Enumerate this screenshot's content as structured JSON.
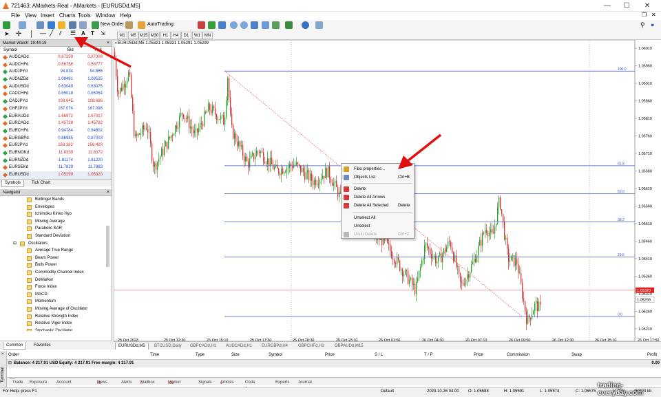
{
  "window": {
    "title": "721463: AMarkets-Real - AMarkets - [EURUSDd,M5]",
    "controls": [
      "—",
      "☐",
      "✕"
    ]
  },
  "menu": [
    "File",
    "View",
    "Insert",
    "Charts",
    "Tools",
    "Window",
    "Help"
  ],
  "toolbar": {
    "new_order": "New Order",
    "autotrading": "AutoTrading",
    "timeframes": [
      "M1",
      "M5",
      "M15",
      "M30",
      "H1",
      "H4",
      "D1",
      "W1",
      "MN"
    ]
  },
  "market_watch": {
    "title": "Market Watch: 19:44:19",
    "columns": [
      "Symbol",
      "Bid",
      "Ask"
    ],
    "rows": [
      {
        "symbol": "AUDCADd",
        "bid": "0.87259",
        "ask": "0.87308",
        "color": "#d62b2b"
      },
      {
        "symbol": "AUDCHFd",
        "bid": "0.56756",
        "ask": "0.56777",
        "color": "#d62b2b"
      },
      {
        "symbol": "AUDJPYd",
        "bid": "94.834",
        "ask": "94.865",
        "color": "#2147d8"
      },
      {
        "symbol": "AUDNZDd",
        "bid": "1.08481",
        "ask": "1.08525",
        "color": "#2147d8"
      },
      {
        "symbol": "AUDUSDd",
        "bid": "0.63049",
        "ask": "0.63075",
        "color": "#2147d8"
      },
      {
        "symbol": "CADCHFd",
        "bid": "0.65018",
        "ask": "0.65054",
        "color": "#2147d8"
      },
      {
        "symbol": "CADJPYd",
        "bid": "108.645",
        "ask": "108.686",
        "color": "#d62b2b"
      },
      {
        "symbol": "CHFJPYd",
        "bid": "167.074",
        "ask": "167.098",
        "color": "#2147d8"
      },
      {
        "symbol": "EURAUDd",
        "bid": "1.66972",
        "ask": "1.67017",
        "color": "#d62b2b"
      },
      {
        "symbol": "EURCADd",
        "bid": "1.45738",
        "ask": "1.45782",
        "color": "#d62b2b"
      },
      {
        "symbol": "EURCHFd",
        "bid": "0.94784",
        "ask": "0.94802",
        "color": "#2147d8"
      },
      {
        "symbol": "EURGBPd",
        "bid": "0.86985",
        "ask": "0.87003",
        "color": "#2147d8"
      },
      {
        "symbol": "EURJPYd",
        "bid": "158.382",
        "ask": "158.403",
        "color": "#d62b2b"
      },
      {
        "symbol": "EURNOKd",
        "bid": "11.8339",
        "ask": "11.8372",
        "color": "#d62b2b"
      },
      {
        "symbol": "EURNZDd",
        "bid": "1.81174",
        "ask": "1.81220",
        "color": "#2147d8"
      },
      {
        "symbol": "EURSEKd",
        "bid": "11.7829",
        "ask": "11.7883",
        "color": "#2147d8"
      },
      {
        "symbol": "EURUSDd",
        "bid": "1.05299",
        "ask": "1.05320",
        "color": "#d62b2b"
      }
    ],
    "tabs": [
      "Symbols",
      "Tick Chart"
    ]
  },
  "navigator": {
    "title": "Navigator",
    "items": [
      "Bollinger Bands",
      "Envelopes",
      "Ichimoku Kinko Hyo",
      "Moving Average",
      "Parabolic SAR",
      "Standard Deviation"
    ],
    "group": "Oscillators",
    "oscillators": [
      "Average True Range",
      "Bears Power",
      "Bulls Power",
      "Commodity Channel Index",
      "DeMarker",
      "Force Index",
      "MACD",
      "Momentum",
      "Moving Average of Oscillator",
      "Relative Strength Index",
      "Relative Vigor Index",
      "Stochastic Oscillator"
    ],
    "tabs": [
      "Common",
      "Favorites"
    ]
  },
  "chart": {
    "header": "EURUSDd,M5  1.05321 1.05321 1.05291 1.05299",
    "price_labels": [
      "1.06010",
      "1.05960",
      "1.05910",
      "1.05860",
      "1.05810",
      "1.05760",
      "1.05710",
      "1.05660",
      "1.05610",
      "1.05560",
      "1.05510",
      "1.05460",
      "1.05410",
      "1.05360",
      "1.05310",
      "1.05260",
      "1.05210"
    ],
    "time_labels": [
      "25 Oct 2023",
      "25 Oct 12:30",
      "25 Oct 15:10",
      "25 Oct 17:50",
      "25 Oct 20:30",
      "25 Oct 23:10",
      "26 Oct 01:50",
      "26 Oct 04:30",
      "26 Oct 07:10",
      "26 Oct 09:50",
      "26 Oct 12:30",
      "26 Oct 15:10",
      "26 Oct 17:50"
    ],
    "fibo_levels": [
      "100.0",
      "61.8",
      "50.0",
      "38.2",
      "23.6",
      "0.0"
    ],
    "bid_price": "1.05320",
    "ask_price": "1.05299",
    "tabs": [
      "EURUSDd,M5",
      "BTCUSD,Daily",
      "GBPCADd,H1",
      "AUDCADd,H1",
      "EURGBPd,H4",
      "GBPCHFd,H1",
      "GBPAUDd,M15"
    ]
  },
  "context_menu": {
    "items": [
      {
        "label": "Fibo properties...",
        "key": "",
        "icon": "fibo-properties-icon"
      },
      {
        "label": "Objects List",
        "key": "Ctrl+B",
        "icon": "objects-list-icon"
      },
      {
        "label": "Delete",
        "key": "",
        "icon": "delete-icon"
      },
      {
        "label": "Delete All Arrows",
        "key": "",
        "icon": "delete-arrows-icon"
      },
      {
        "label": "Delete All Selected",
        "key": "Delete",
        "icon": "delete-selected-icon"
      },
      {
        "label": "Unselect All",
        "key": "",
        "icon": ""
      },
      {
        "label": "Unselect",
        "key": "",
        "icon": ""
      },
      {
        "label": "Undo Delete",
        "key": "Ctrl+Z",
        "icon": "undo-icon"
      }
    ]
  },
  "terminal": {
    "side_label": "Terminal",
    "columns": [
      "Order",
      "Time",
      "Type",
      "Size",
      "Symbol",
      "Price",
      "S / L",
      "T / P",
      "Price",
      "Commission",
      "Swap",
      "Profit"
    ],
    "balance": "Balance: 4 217.91 USD  Equity: 4 217.91  Free margin: 4 217.91",
    "profit": "0.00",
    "tabs": [
      {
        "label": "Trade",
        "badge": ""
      },
      {
        "label": "Exposure",
        "badge": ""
      },
      {
        "label": "Account History",
        "badge": ""
      },
      {
        "label": "News",
        "badge": "99"
      },
      {
        "label": "Alerts",
        "badge": ""
      },
      {
        "label": "Mailbox",
        "badge": "6"
      },
      {
        "label": "Market",
        "badge": "103"
      },
      {
        "label": "Signals",
        "badge": ""
      },
      {
        "label": "Articles",
        "badge": "1"
      },
      {
        "label": "Code Base",
        "badge": ""
      },
      {
        "label": "Experts",
        "badge": ""
      },
      {
        "label": "Journal",
        "badge": ""
      }
    ]
  },
  "status": {
    "help": "For Help, press F1",
    "profile": "Default",
    "datetime": "2023.10.26 04:00",
    "open": "O: 1.05588",
    "high": "H: 1.05591",
    "low": "L: 1.05574",
    "close": "C: 1.05575",
    "volume": "V: 228",
    "traffic": "4639/3 kb"
  },
  "watermark": "trading-everyday.com",
  "colors": {
    "bull": "#2aa12a",
    "bear": "#e03030",
    "fibo_line": "#3f57c9",
    "grid": "#e6e6e6",
    "arrow": "#e01010"
  }
}
